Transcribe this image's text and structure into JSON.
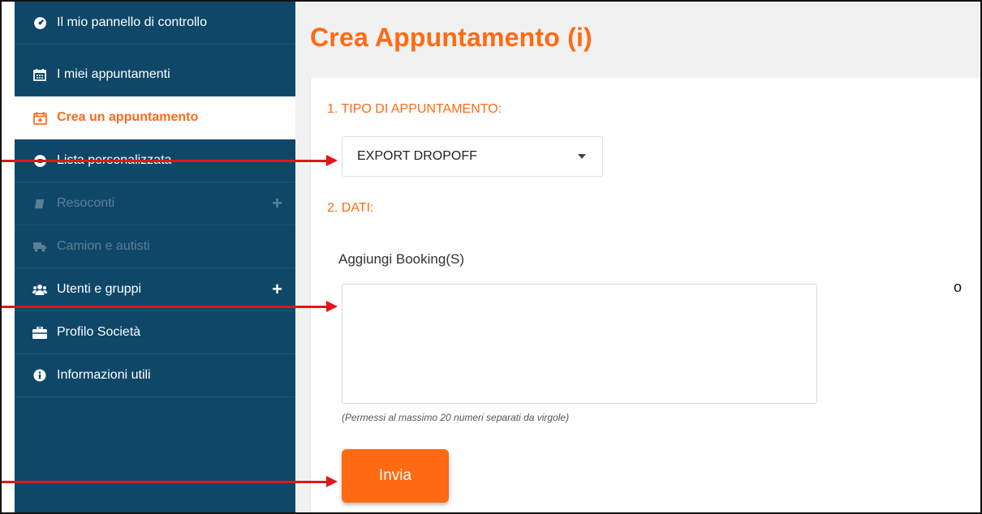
{
  "sidebar": {
    "items": [
      {
        "label": "Il mio pannello di controllo",
        "icon": "dashboard-icon"
      },
      {
        "label": "I miei appuntamenti",
        "icon": "calendar-icon"
      },
      {
        "label": "Crea un appuntamento",
        "icon": "calendar-plus-icon",
        "active": true
      },
      {
        "label": "Lista personalizzata",
        "icon": "eye-icon"
      },
      {
        "label": "Resoconti",
        "icon": "book-icon",
        "disabled": true,
        "has_plus": true
      },
      {
        "label": "Camion e autisti",
        "icon": "truck-icon",
        "disabled": true
      },
      {
        "label": "Utenti e gruppi",
        "icon": "users-icon",
        "has_plus": true
      },
      {
        "label": "Profilo Società",
        "icon": "briefcase-icon"
      },
      {
        "label": "Informazioni utili",
        "icon": "info-icon"
      }
    ],
    "plus_label": "+"
  },
  "main": {
    "title": "Crea Appuntamento (i)",
    "section1_label": "1. TIPO DI APPUNTAMENTO:",
    "appointment_type": {
      "selected": "EXPORT DROPOFF"
    },
    "section2_label": "2. DATI:",
    "booking_label": "Aggiungi Booking(S)",
    "booking_value": "",
    "hint": "(Permessi al massimo 20 numeri separati da virgole)",
    "or_text": "o",
    "submit_label": "Invia"
  },
  "colors": {
    "sidebar_bg": "#0f4769",
    "accent": "#ff6a13",
    "arrow": "#e0161b"
  }
}
